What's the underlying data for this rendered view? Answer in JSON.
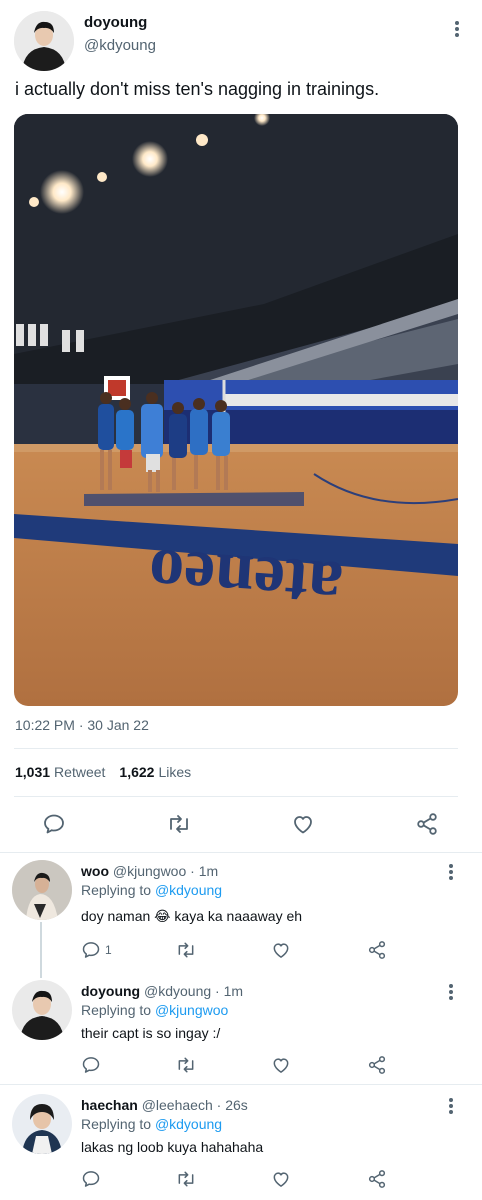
{
  "main_tweet": {
    "author_name": "doyoung",
    "author_handle": "@kdyoung",
    "text": "i actually don't miss ten's nagging in trainings.",
    "timestamp": "10:22 PM · 30 Jan 22",
    "retweets_count": "1,031",
    "retweets_label": "Retweet",
    "likes_count": "1,622",
    "likes_label": "Likes",
    "photo_floor_text": "ateneo"
  },
  "replies": [
    {
      "name": "woo",
      "handle": "@kjungwoo",
      "time": "· 1m",
      "replying_label": "Replying to",
      "replying_to": "@kdyoung",
      "text": "doy naman 😂 kaya ka naaaway eh",
      "reply_count": "1"
    },
    {
      "name": "doyoung",
      "handle": "@kdyoung",
      "time": "· 1m",
      "replying_label": "Replying to",
      "replying_to": "@kjungwoo",
      "text": "their capt is so ingay :/",
      "reply_count": ""
    },
    {
      "name": "haechan",
      "handle": "@leehaech",
      "time": "· 26s",
      "replying_label": "Replying to",
      "replying_to": "@kdyoung",
      "text": "lakas ng loob kuya hahahaha",
      "reply_count": ""
    }
  ],
  "icons": {
    "reply": "reply-icon",
    "retweet": "retweet-icon",
    "like": "heart-icon",
    "share": "share-icon",
    "more": "more-options-icon"
  },
  "colors": {
    "accent": "#1d9bf0",
    "text": "#0f1419",
    "secondary": "#536471",
    "divider": "#e6ecf0"
  }
}
